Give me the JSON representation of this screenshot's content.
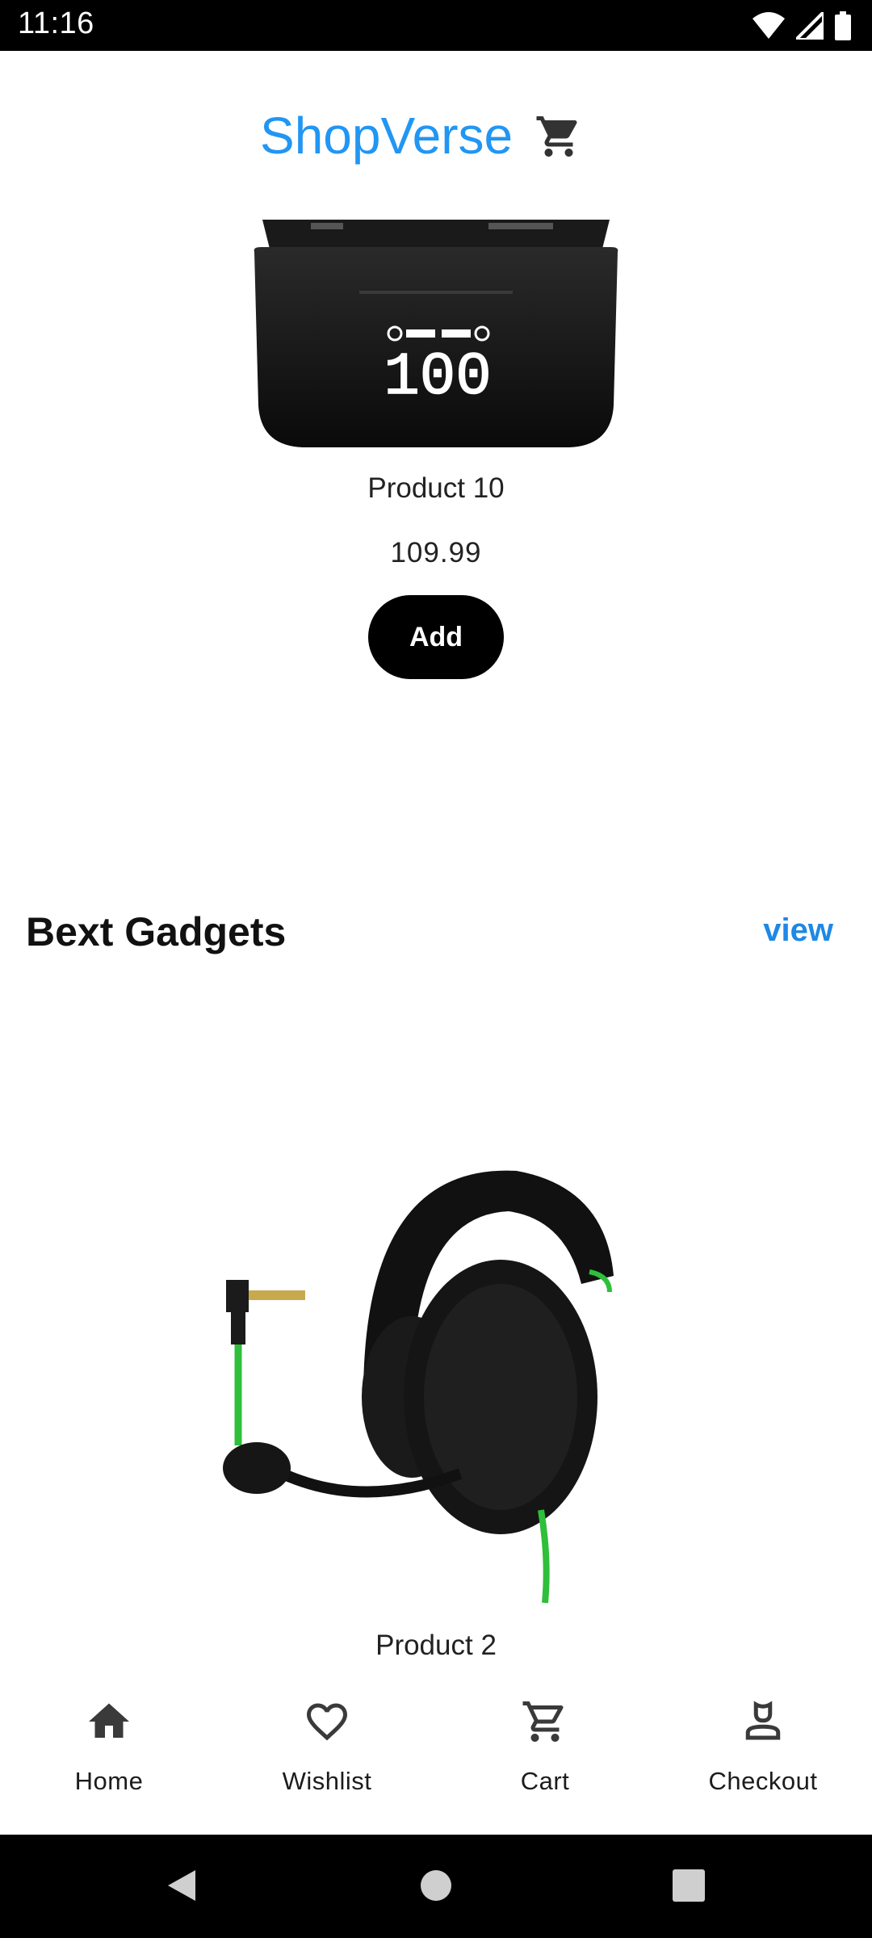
{
  "status_bar": {
    "time": "11:16",
    "icons": [
      "wifi-icon",
      "signal-icon",
      "battery-icon"
    ]
  },
  "header": {
    "title": "ShopVerse",
    "cart_icon": "cart-icon",
    "title_color": "#2196f3"
  },
  "featured_product": {
    "name": "Product 10",
    "price": "109.99",
    "add_label": "Add",
    "image": "earbuds-case-image"
  },
  "section": {
    "title": "Bext Gadgets",
    "link_label": "view",
    "link_color": "#1e88e5"
  },
  "second_product": {
    "name": "Product 2",
    "image": "gaming-headset-image"
  },
  "bottom_nav": {
    "items": [
      {
        "label": "Home",
        "icon": "home-icon"
      },
      {
        "label": "Wishlist",
        "icon": "heart-icon"
      },
      {
        "label": "Cart",
        "icon": "cart-icon"
      },
      {
        "label": "Checkout",
        "icon": "person-icon"
      }
    ]
  },
  "system_nav": {
    "icons": [
      "back-icon",
      "home-circle-icon",
      "recents-icon"
    ]
  }
}
